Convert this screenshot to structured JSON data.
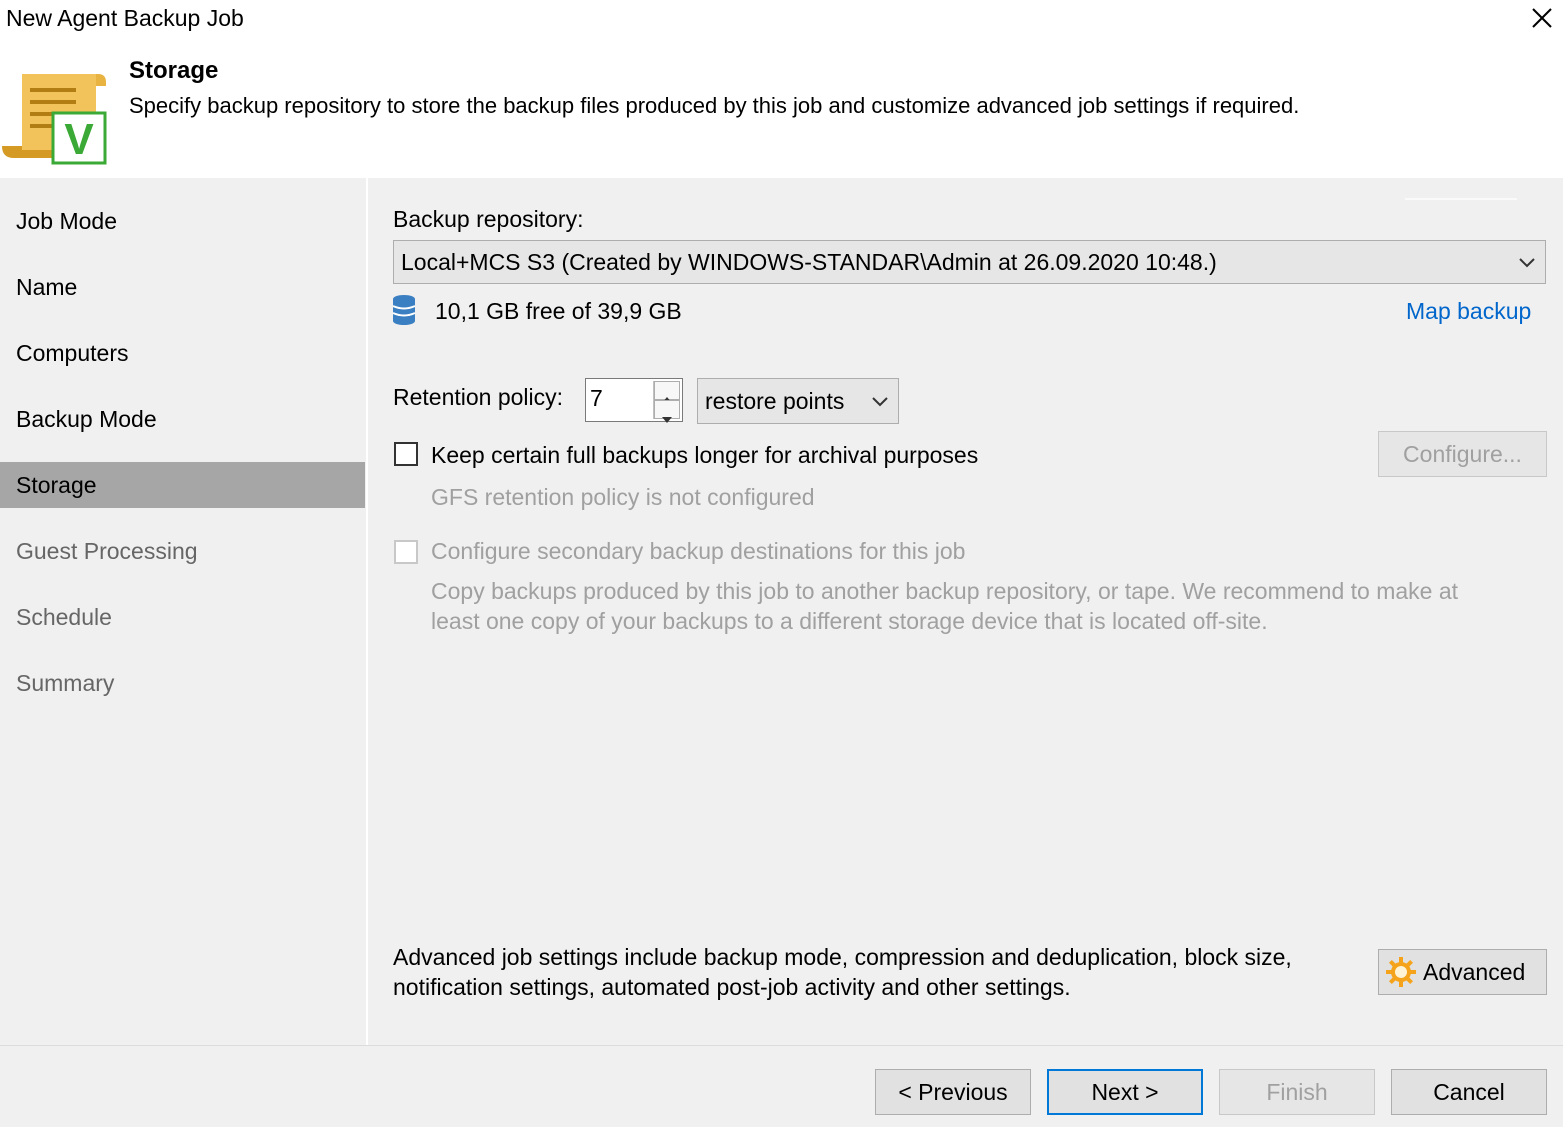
{
  "window": {
    "title": "New Agent Backup Job",
    "close_icon": "close-icon"
  },
  "header": {
    "title": "Storage",
    "description": "Specify backup repository to store the backup files produced by this job and customize advanced job settings if required.",
    "icon": "backup-job-scroll-icon",
    "icon_badge": "V"
  },
  "sidebar": {
    "items": [
      {
        "label": "Job Mode",
        "state": "normal"
      },
      {
        "label": "Name",
        "state": "normal"
      },
      {
        "label": "Computers",
        "state": "normal"
      },
      {
        "label": "Backup Mode",
        "state": "normal"
      },
      {
        "label": "Storage",
        "state": "active"
      },
      {
        "label": "Guest Processing",
        "state": "dim"
      },
      {
        "label": "Schedule",
        "state": "dim"
      },
      {
        "label": "Summary",
        "state": "dim"
      }
    ]
  },
  "storage": {
    "repository_label": "Backup repository:",
    "repository_value": "Local+MCS S3 (Created by WINDOWS-STANDAR\\Admin at 26.09.2020 10:48.)",
    "free_space": "10,1 GB free of 39,9 GB",
    "map_backup": "Map backup",
    "retention_label": "Retention policy:",
    "retention_value": "7",
    "retention_unit": "restore points",
    "gfs_checkbox_label": "Keep certain full backups longer for archival purposes",
    "gfs_checked": false,
    "configure_button": "Configure...",
    "gfs_status": "GFS retention policy is not configured",
    "secondary_checkbox_label": "Configure secondary backup destinations for this job",
    "secondary_checked": false,
    "secondary_desc_line1": "Copy backups produced by this job to another backup repository, or tape. We recommend to make at",
    "secondary_desc_line2": "least one copy of your backups to a different storage device that is located off-site.",
    "advanced_desc_line1": "Advanced job settings include backup mode, compression and deduplication, block size,",
    "advanced_desc_line2": "notification settings, automated post-job activity and other settings.",
    "advanced_button": "Advanced"
  },
  "footer": {
    "previous": "< Previous",
    "next": "Next >",
    "finish": "Finish",
    "cancel": "Cancel"
  },
  "colors": {
    "link": "#0066cc",
    "active_nav": "#a6a6a6",
    "panel_bg": "#f0f0f0",
    "icon_gold": "#e8b341",
    "icon_green": "#3aa935",
    "database_blue": "#3a7fc1",
    "gear_orange": "#f5a31a",
    "primary_border": "#0078d7"
  }
}
